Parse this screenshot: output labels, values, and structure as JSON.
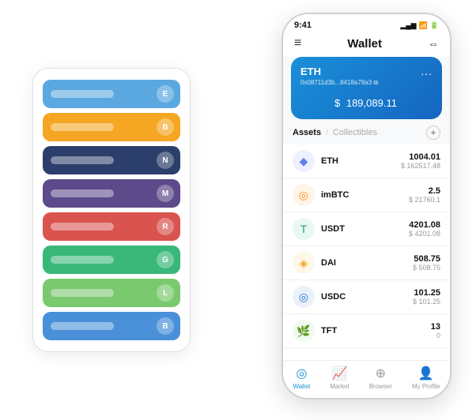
{
  "header": {
    "title": "Wallet",
    "time": "9:41",
    "menu_icon": "≡",
    "scan_icon": "⇔"
  },
  "eth_card": {
    "title": "ETH",
    "address": "0x08711d3b...8418a78a3",
    "copy_icon": "⧉",
    "dots": "...",
    "balance_prefix": "$",
    "balance": "189,089.11"
  },
  "assets": {
    "active_tab": "Assets",
    "separator": "/",
    "inactive_tab": "Collectibles",
    "add_icon": "+"
  },
  "asset_list": [
    {
      "name": "ETH",
      "icon": "◆",
      "icon_color": "#627eea",
      "icon_bg": "#eef0ff",
      "amount": "1004.01",
      "value": "$ 162517.48"
    },
    {
      "name": "imBTC",
      "icon": "◎",
      "icon_color": "#f7931a",
      "icon_bg": "#fff4e8",
      "amount": "2.5",
      "value": "$ 21760.1"
    },
    {
      "name": "USDT",
      "icon": "T",
      "icon_color": "#26a17b",
      "icon_bg": "#e8f8f3",
      "amount": "4201.08",
      "value": "$ 4201.08"
    },
    {
      "name": "DAI",
      "icon": "◈",
      "icon_color": "#f5a623",
      "icon_bg": "#fff8e8",
      "amount": "508.75",
      "value": "$ 508.75"
    },
    {
      "name": "USDC",
      "icon": "◎",
      "icon_color": "#2775ca",
      "icon_bg": "#eaf1fb",
      "amount": "101.25",
      "value": "$ 101.25"
    },
    {
      "name": "TFT",
      "icon": "🌿",
      "icon_color": "#4caf50",
      "icon_bg": "#f0faf0",
      "amount": "13",
      "value": "0"
    }
  ],
  "bottom_nav": [
    {
      "label": "Wallet",
      "icon": "◎",
      "active": true
    },
    {
      "label": "Market",
      "icon": "📈",
      "active": false
    },
    {
      "label": "Browser",
      "icon": "⊕",
      "active": false
    },
    {
      "label": "My Profile",
      "icon": "👤",
      "active": false
    }
  ],
  "card_stack": {
    "cards": [
      {
        "color": "#5ba8e0",
        "icon_letter": "E"
      },
      {
        "color": "#f5a623",
        "icon_letter": "B"
      },
      {
        "color": "#2c3e6b",
        "icon_letter": "N"
      },
      {
        "color": "#5c4a8a",
        "icon_letter": "M"
      },
      {
        "color": "#d9534f",
        "icon_letter": "R"
      },
      {
        "color": "#3ab87a",
        "icon_letter": "G"
      },
      {
        "color": "#7bc96f",
        "icon_letter": "L"
      },
      {
        "color": "#4a90d9",
        "icon_letter": "B"
      }
    ]
  }
}
